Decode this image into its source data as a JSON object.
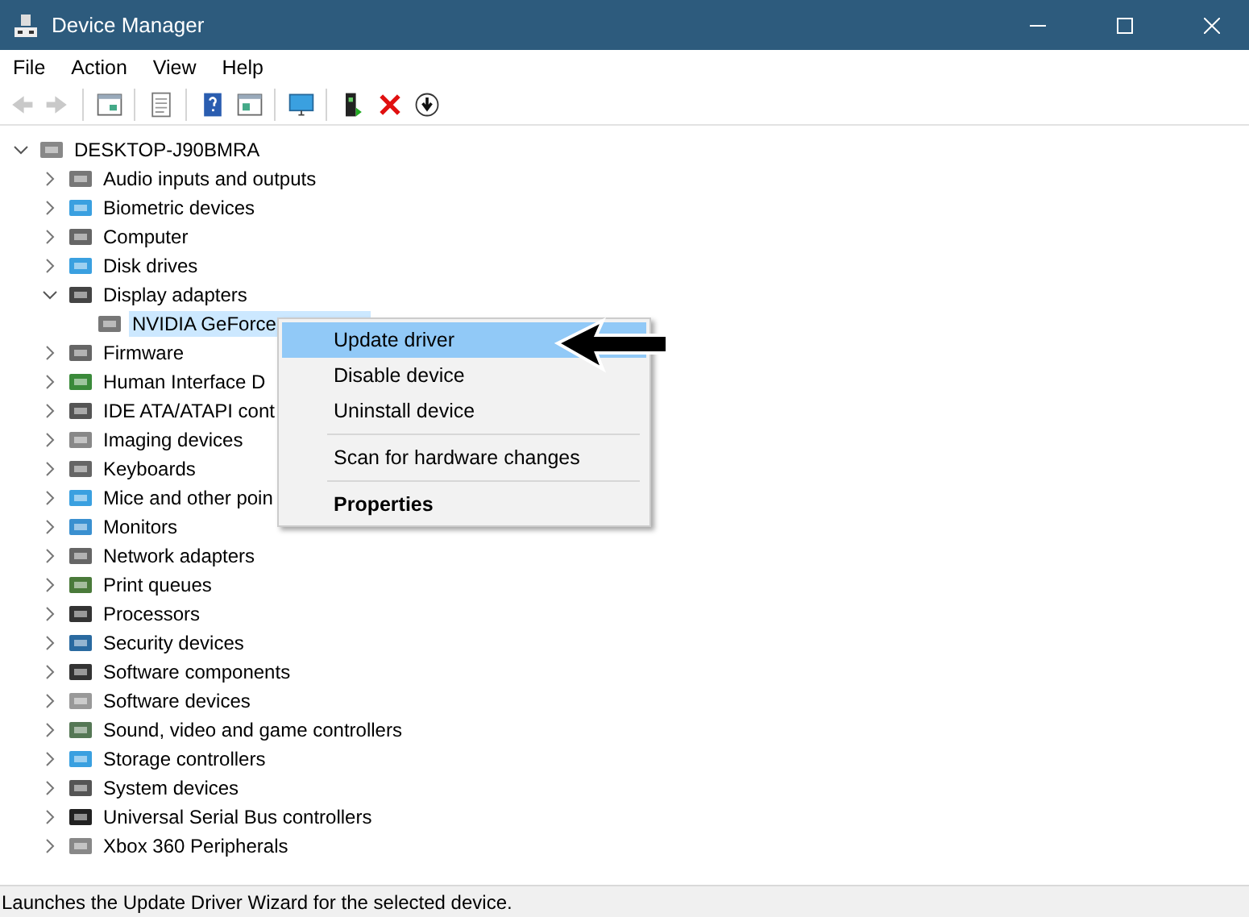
{
  "window": {
    "title": "Device Manager"
  },
  "menu_bar": [
    "File",
    "Action",
    "View",
    "Help"
  ],
  "toolbar": [
    {
      "disabled": true
    },
    {
      "disabled": true
    },
    {
      "disabled": false
    },
    {
      "disabled": false
    },
    {
      "disabled": false
    },
    {
      "disabled": false
    },
    {
      "disabled": false
    },
    {
      "disabled": false
    },
    {
      "disabled": false
    },
    {
      "disabled": false
    }
  ],
  "tree": {
    "label": "DESKTOP-J90BMRA",
    "expanded": true,
    "selected": false,
    "children": [
      {
        "label": "Audio inputs and outputs",
        "expanded": false,
        "selected": false
      },
      {
        "label": "Biometric devices",
        "expanded": false,
        "selected": false
      },
      {
        "label": "Computer",
        "expanded": false,
        "selected": false
      },
      {
        "label": "Disk drives",
        "expanded": false,
        "selected": false
      },
      {
        "label": "Display adapters",
        "expanded": true,
        "selected": false,
        "children": [
          {
            "label": "NVIDIA GeForce",
            "selected": true
          }
        ]
      },
      {
        "label": "Firmware",
        "expanded": false,
        "selected": false
      },
      {
        "label": "Human Interface D",
        "expanded": false,
        "selected": false
      },
      {
        "label": "IDE ATA/ATAPI cont",
        "expanded": false,
        "selected": false
      },
      {
        "label": "Imaging devices",
        "expanded": false,
        "selected": false
      },
      {
        "label": "Keyboards",
        "expanded": false,
        "selected": false
      },
      {
        "label": "Mice and other poin",
        "expanded": false,
        "selected": false
      },
      {
        "label": "Monitors",
        "expanded": false,
        "selected": false
      },
      {
        "label": "Network adapters",
        "expanded": false,
        "selected": false
      },
      {
        "label": "Print queues",
        "expanded": false,
        "selected": false
      },
      {
        "label": "Processors",
        "expanded": false,
        "selected": false
      },
      {
        "label": "Security devices",
        "expanded": false,
        "selected": false
      },
      {
        "label": "Software components",
        "expanded": false,
        "selected": false
      },
      {
        "label": "Software devices",
        "expanded": false,
        "selected": false
      },
      {
        "label": "Sound, video and game controllers",
        "expanded": false,
        "selected": false
      },
      {
        "label": "Storage controllers",
        "expanded": false,
        "selected": false
      },
      {
        "label": "System devices",
        "expanded": false,
        "selected": false
      },
      {
        "label": "Universal Serial Bus controllers",
        "expanded": false,
        "selected": false
      },
      {
        "label": "Xbox 360 Peripherals",
        "expanded": false,
        "selected": false
      }
    ]
  },
  "context_menu": [
    {
      "label": "Update driver",
      "selected": true,
      "default": false,
      "separator_before": false
    },
    {
      "label": "Disable device",
      "selected": false,
      "default": false,
      "separator_before": false
    },
    {
      "label": "Uninstall device",
      "selected": false,
      "default": false,
      "separator_before": false
    },
    {
      "label": "Scan for hardware changes",
      "selected": false,
      "default": false,
      "separator_before": true
    },
    {
      "label": "Properties",
      "selected": false,
      "default": true,
      "separator_before": true
    }
  ],
  "status_bar": "Launches the Update Driver Wizard for the selected device."
}
